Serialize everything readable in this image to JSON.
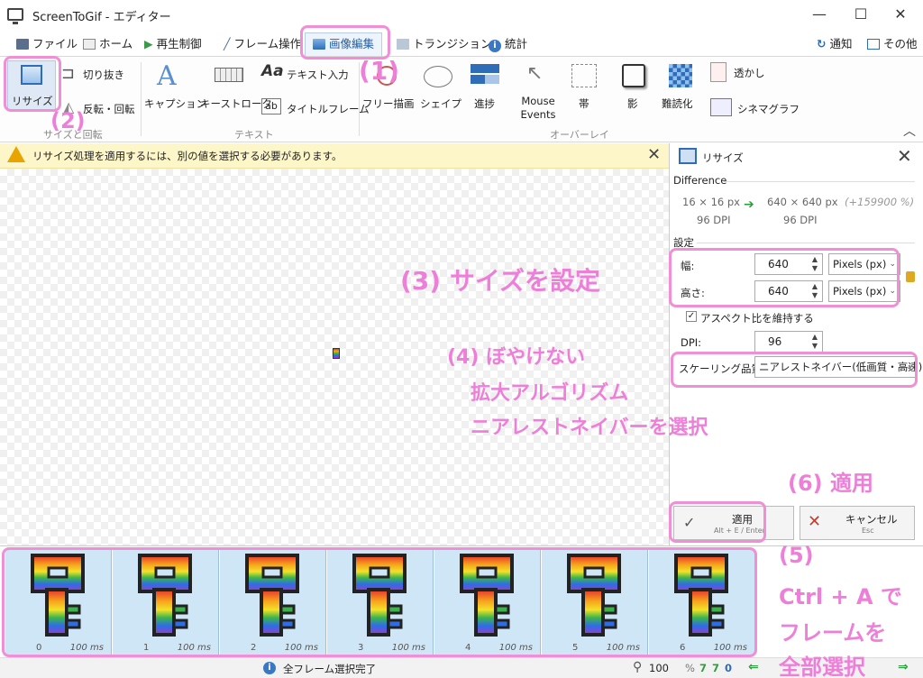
{
  "window": {
    "title": "ScreenToGif - エディター",
    "minimize": "—",
    "maximize": "☐",
    "close": "✕"
  },
  "tabs": [
    {
      "label": "ファイル"
    },
    {
      "label": "ホーム"
    },
    {
      "label": "再生制御"
    },
    {
      "label": "フレーム操作"
    },
    {
      "label": "画像編集"
    },
    {
      "label": "トランジション"
    },
    {
      "label": "統計"
    }
  ],
  "right_tabs": {
    "notify": "通知",
    "other": "その他"
  },
  "ribbon": {
    "resize": "リサイズ",
    "crop": "切り抜き",
    "flip_rotate": "反転・回転",
    "group_size": "サイズと回転",
    "caption": "キャプション",
    "keystroke": "キーストローク",
    "text_input": "テキスト入力",
    "title_frame": "タイトルフレーム",
    "group_text": "テキスト",
    "free_draw": "フリー描画",
    "shape": "シェイプ",
    "progress": "進捗",
    "mouse_events": "Mouse Events",
    "band": "帯",
    "shadow": "影",
    "obfuscate": "難読化",
    "watermark": "透かし",
    "cinemagraph": "シネマグラフ",
    "group_overlay": "オーバーレイ",
    "text_glyph_aa": "Aa",
    "text_glyph_ab": "ab"
  },
  "warning": {
    "text": "リサイズ処理を適用するには、別の値を選択する必要があります。"
  },
  "panel": {
    "title": "リサイズ",
    "difference_header": "Difference",
    "from_size": "16 × 16 px",
    "to_size": "640 × 640 px",
    "percent": "(+159900 %)",
    "from_dpi": "96 DPI",
    "to_dpi": "96 DPI",
    "settings_header": "設定",
    "width_label": "幅:",
    "width_value": "640",
    "width_unit": "Pixels (px)",
    "height_label": "高さ:",
    "height_value": "640",
    "height_unit": "Pixels (px)",
    "keep_aspect": "アスペクト比を維持する",
    "dpi_label": "DPI:",
    "dpi_value": "96",
    "scaling_label": "スケーリング品質:",
    "scaling_value": "ニアレストネイバー(低画質・高速)",
    "apply": "適用",
    "apply_shortcut": "Alt + E / Enter",
    "cancel": "キャンセル",
    "cancel_shortcut": "Esc"
  },
  "frames": [
    {
      "index": "0",
      "delay": "100 ms"
    },
    {
      "index": "1",
      "delay": "100 ms"
    },
    {
      "index": "2",
      "delay": "100 ms"
    },
    {
      "index": "3",
      "delay": "100 ms"
    },
    {
      "index": "4",
      "delay": "100 ms"
    },
    {
      "index": "5",
      "delay": "100 ms"
    },
    {
      "index": "6",
      "delay": "100 ms"
    }
  ],
  "status": {
    "message": "全フレーム選択完了",
    "zoom": "100",
    "zoom_unit": "%",
    "count_total": "7",
    "count_selected": "7",
    "count_zero": "0"
  },
  "annotations": {
    "step1": "(1)",
    "step2": "(2)",
    "step3": "(3) サイズを設定",
    "step4_line1": "(4) ぼやけない",
    "step4_line2": "拡大アルゴリズム",
    "step4_line3": "ニアレストネイバーを選択",
    "step5_line1": "(5)",
    "step5_line2": "Ctrl + A で",
    "step5_line3": "フレームを",
    "step5_line4": "全部選択",
    "step6": "(6) 適用"
  },
  "colors": {
    "accent": "#1f5fa8",
    "annotation": "#ee7fd8",
    "warning_bg": "#fdf6c8",
    "frame_bg": "#cfe6f6",
    "status_green": "#2e9e3e"
  }
}
